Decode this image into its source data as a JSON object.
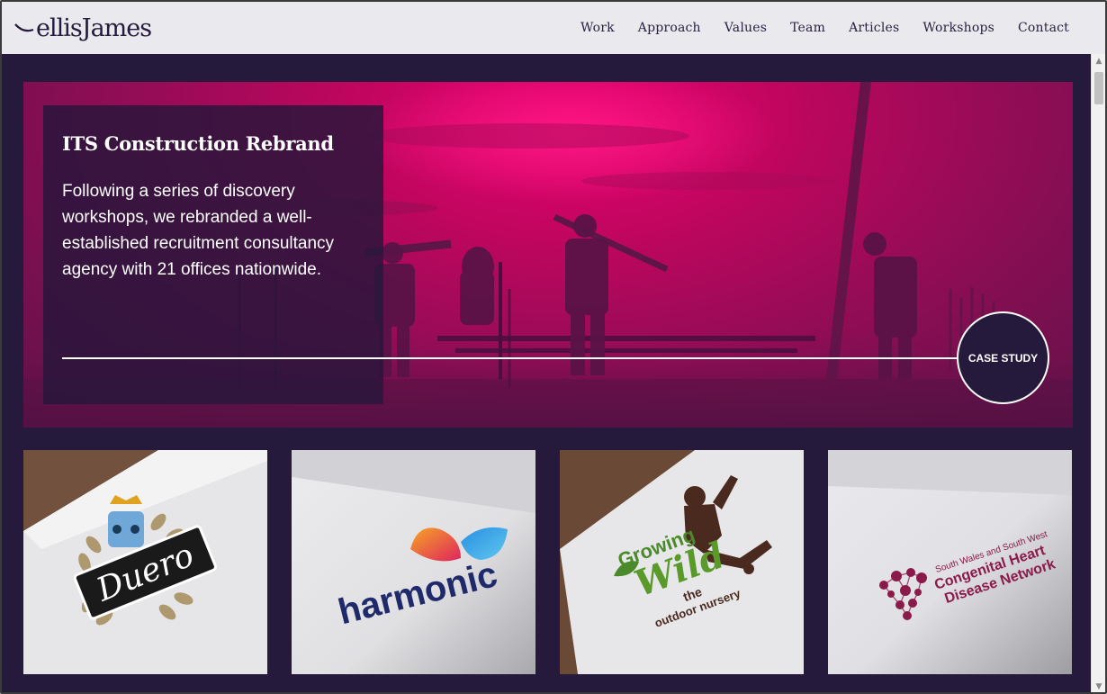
{
  "brand": {
    "logo_text": "ellisJames",
    "color": "#261a3c"
  },
  "nav": {
    "items": [
      {
        "label": "Work"
      },
      {
        "label": "Approach"
      },
      {
        "label": "Values"
      },
      {
        "label": "Team"
      },
      {
        "label": "Articles"
      },
      {
        "label": "Workshops"
      },
      {
        "label": "Contact"
      }
    ]
  },
  "hero": {
    "title": "ITS Construction Rebrand",
    "description": "Following a series of discovery workshops, we rebranded a well-established recruitment consultancy agency with 21 offices nationwide.",
    "cta_label": "CASE STUDY",
    "accent_color": "#c0065f"
  },
  "tiles": [
    {
      "name": "duero",
      "logo_text": "Duero"
    },
    {
      "name": "harmonic",
      "logo_text": "harmonic"
    },
    {
      "name": "growing-wild",
      "logo_line1": "Growing",
      "logo_line2": "Wild",
      "logo_line3": "the",
      "logo_line4": "outdoor nursery"
    },
    {
      "name": "congenital-heart",
      "logo_small": "South Wales and South West",
      "logo_line1": "Congenital Heart",
      "logo_line2": "Disease Network"
    }
  ]
}
